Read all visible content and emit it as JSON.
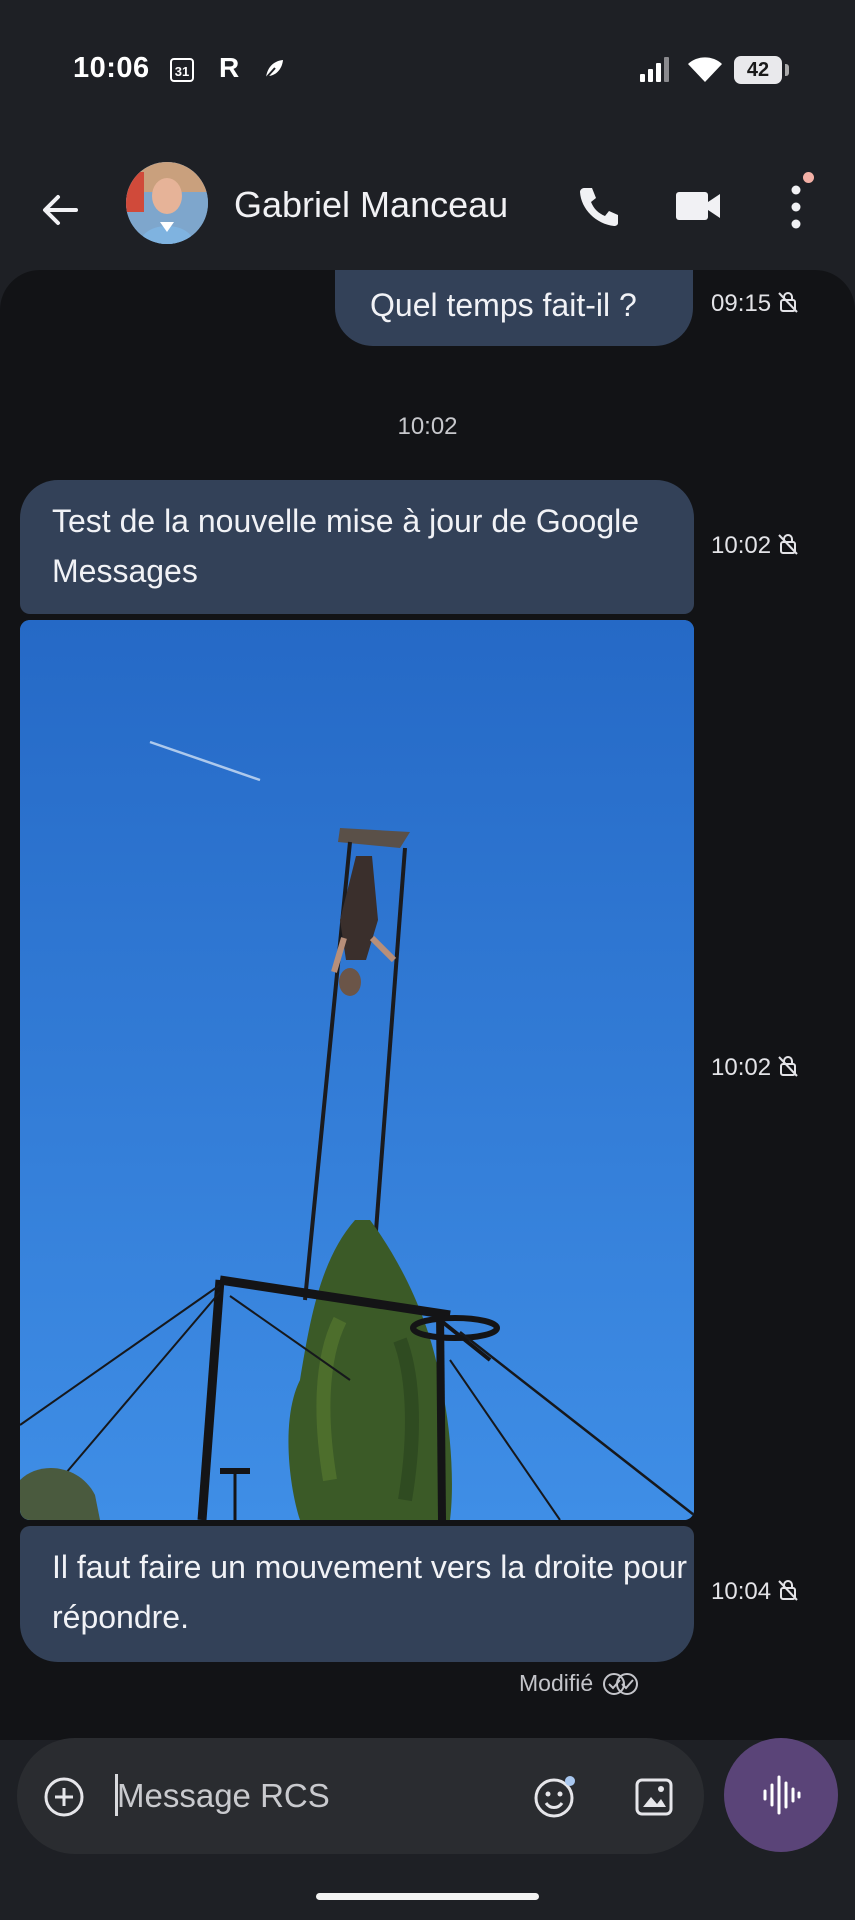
{
  "status_bar": {
    "time": "10:06",
    "calendar_day": "31",
    "r_label": "R",
    "battery": "42"
  },
  "app_bar": {
    "contact_name": "Gabriel Manceau"
  },
  "messages": [
    {
      "direction": "outgoing",
      "type": "text",
      "text": "Quel temps fait-il ?",
      "time": "09:15"
    },
    {
      "direction": "incoming",
      "type": "text",
      "text": "Test de la nouvelle mise à jour de Google Messages",
      "time": "10:02"
    },
    {
      "direction": "incoming",
      "type": "image",
      "description": "aerial acrobat on trapeze rig against blue sky",
      "time": "10:02"
    },
    {
      "direction": "incoming",
      "type": "text",
      "text": "Il faut faire un mouvement vers la droite pour répondre.",
      "time": "10:04"
    }
  ],
  "date_separator": "10:02",
  "modified_label": "Modifié",
  "composer": {
    "placeholder": "Message RCS"
  },
  "colors": {
    "background": "#1e2025",
    "conversation_bg": "#121316",
    "bubble": "#334158",
    "voice_button": "#5a4478",
    "sky": "#2d72cd"
  },
  "icons": [
    "back-arrow-icon",
    "phone-icon",
    "video-camera-icon",
    "more-vert-icon",
    "add-circle-icon",
    "emoji-icon",
    "gallery-icon",
    "voice-wave-icon",
    "encryption-off-icon",
    "delivered-read-icon"
  ]
}
